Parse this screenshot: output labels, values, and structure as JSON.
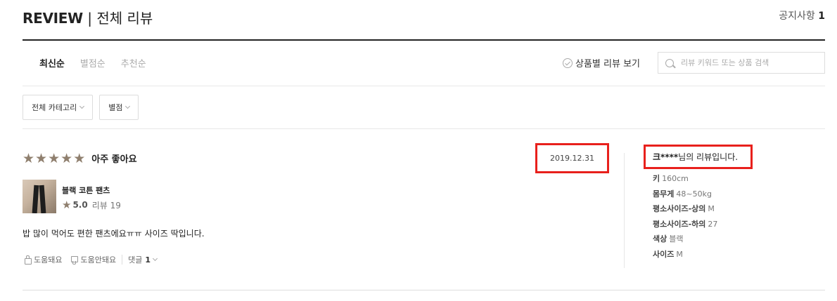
{
  "header": {
    "title_bold": "REVIEW",
    "title_rest": " | 전체 리뷰",
    "notice_label": "공지사항",
    "notice_count": "1"
  },
  "sort": {
    "tabs": [
      {
        "label": "최신순",
        "active": true
      },
      {
        "label": "별점순",
        "active": false
      },
      {
        "label": "추천순",
        "active": false
      }
    ],
    "by_product_label": "상품별 리뷰 보기",
    "search_placeholder": "리뷰 키워드 또는 상품 검색"
  },
  "filters": {
    "category": "전체 카테고리",
    "rating": "별점"
  },
  "review": {
    "stars": 5,
    "rating_text": "아주 좋아요",
    "date": "2019.12.31",
    "product": {
      "name": "블랙 코튼 팬츠",
      "score": "5.0",
      "review_label": "리뷰 19"
    },
    "body": "밥 많이 먹어도 편한 팬츠에요ㅠㅠ 사이즈 딱입니다.",
    "actions": {
      "helpful": "도움돼요",
      "not_helpful": "도움안돼요",
      "comment_label": "댓글",
      "comment_count": "1"
    },
    "user": {
      "name": "크****",
      "suffix": "님의 리뷰입니다."
    },
    "specs": [
      {
        "label": "키",
        "value": "160cm"
      },
      {
        "label": "몸무게",
        "value": "48~50kg"
      },
      {
        "label": "평소사이즈-상의",
        "value": "M"
      },
      {
        "label": "평소사이즈-하의",
        "value": "27"
      },
      {
        "label": "색상",
        "value": "블랙"
      },
      {
        "label": "사이즈",
        "value": "M"
      }
    ]
  },
  "colors": {
    "star": "#8f7f6e",
    "highlight_box": "#e8201c"
  }
}
